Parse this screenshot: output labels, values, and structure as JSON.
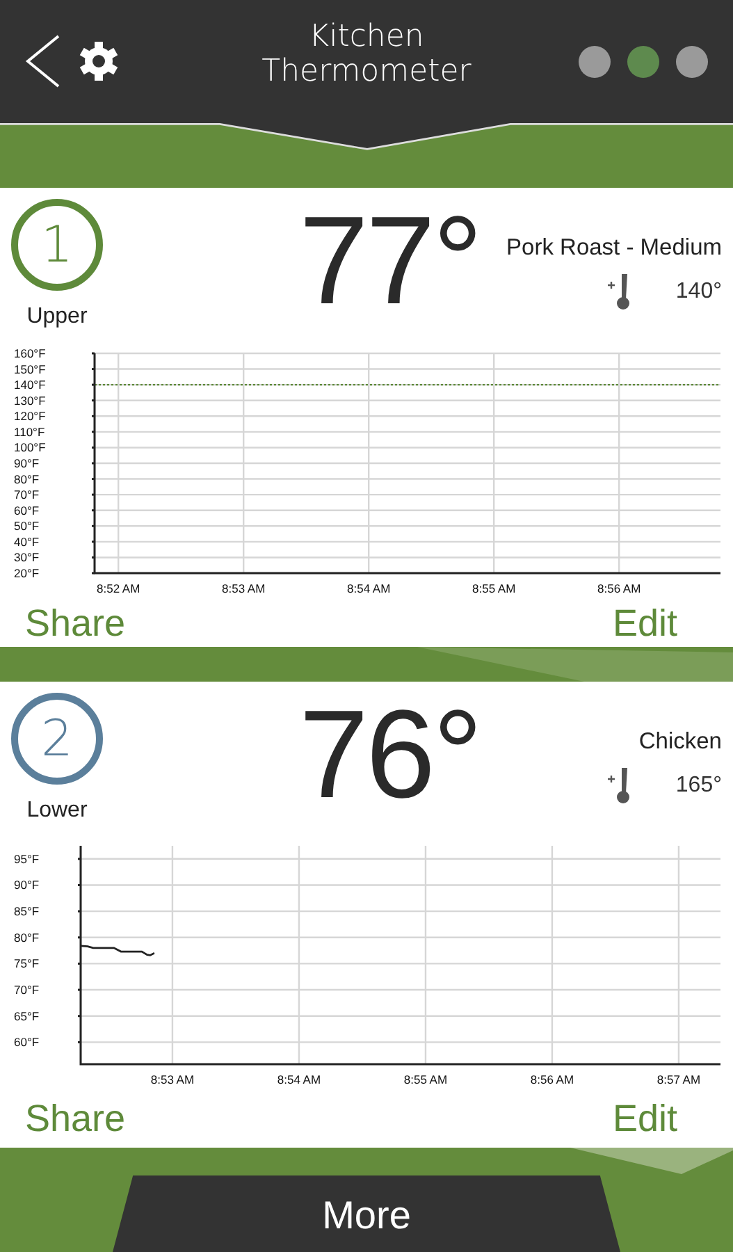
{
  "header": {
    "title_lines": [
      "Kitchen",
      "Thermometer"
    ],
    "page_dots": [
      {
        "selected": false
      },
      {
        "selected": true
      },
      {
        "selected": false
      }
    ]
  },
  "probes": [
    {
      "number": "1",
      "name": "Upper",
      "color": "#5e8a3a",
      "temperature": "77°",
      "food": "Pork Roast - Medium",
      "target": "140°",
      "share": "Share",
      "edit": "Edit",
      "chart_data": {
        "type": "line",
        "grid": true,
        "xlim": [
          531.81,
          536.81
        ],
        "ylim": [
          20,
          160
        ],
        "xticks": [
          {
            "value": 532,
            "label": "8:52 AM"
          },
          {
            "value": 533,
            "label": "8:53 AM"
          },
          {
            "value": 534,
            "label": "8:54 AM"
          },
          {
            "value": 535,
            "label": "8:55 AM"
          },
          {
            "value": 536,
            "label": "8:56 AM"
          }
        ],
        "yticks": [
          {
            "value": 160,
            "label": "160°F"
          },
          {
            "value": 150,
            "label": "150°F"
          },
          {
            "value": 140,
            "label": "140°F"
          },
          {
            "value": 130,
            "label": "130°F"
          },
          {
            "value": 120,
            "label": "120°F"
          },
          {
            "value": 110,
            "label": "110°F"
          },
          {
            "value": 100,
            "label": "100°F"
          },
          {
            "value": 90,
            "label": "90°F"
          },
          {
            "value": 80,
            "label": "80°F"
          },
          {
            "value": 70,
            "label": "70°F"
          },
          {
            "value": 60,
            "label": "60°F"
          },
          {
            "value": 50,
            "label": "50°F"
          },
          {
            "value": 40,
            "label": "40°F"
          },
          {
            "value": 30,
            "label": "30°F"
          },
          {
            "value": 20,
            "label": "20°F"
          }
        ],
        "ref_lines": [
          {
            "axis": "y",
            "value": 140,
            "color": "#5e8a3a"
          }
        ]
      }
    },
    {
      "number": "2",
      "name": "Lower",
      "color": "#5b7f9b",
      "temperature": "76°",
      "food": "Chicken",
      "target": "165°",
      "share": "Share",
      "edit": "Edit",
      "chart_data": {
        "type": "line",
        "grid": true,
        "xlim": [
          532.275,
          537.33
        ],
        "ylim": [
          55.8,
          97.5
        ],
        "xticks": [
          {
            "value": 533,
            "label": "8:53 AM"
          },
          {
            "value": 534,
            "label": "8:54 AM"
          },
          {
            "value": 535,
            "label": "8:55 AM"
          },
          {
            "value": 536,
            "label": "8:56 AM"
          },
          {
            "value": 537,
            "label": "8:57 AM"
          }
        ],
        "yticks": [
          {
            "value": 95,
            "label": "95°F"
          },
          {
            "value": 90,
            "label": "90°F"
          },
          {
            "value": 85,
            "label": "85°F"
          },
          {
            "value": 80,
            "label": "80°F"
          },
          {
            "value": 75,
            "label": "75°F"
          },
          {
            "value": 70,
            "label": "70°F"
          },
          {
            "value": 65,
            "label": "65°F"
          },
          {
            "value": 60,
            "label": "60°F"
          }
        ],
        "x": [
          532.275,
          532.33,
          532.374,
          532.538,
          532.593,
          532.758,
          532.8,
          532.824,
          532.857
        ],
        "series": [
          {
            "color": "#222222",
            "values": [
              78.4,
              78.3,
              78,
              78,
              77.3,
              77.3,
              76.7,
              76.6,
              77
            ]
          }
        ]
      }
    }
  ],
  "more_button": "More"
}
